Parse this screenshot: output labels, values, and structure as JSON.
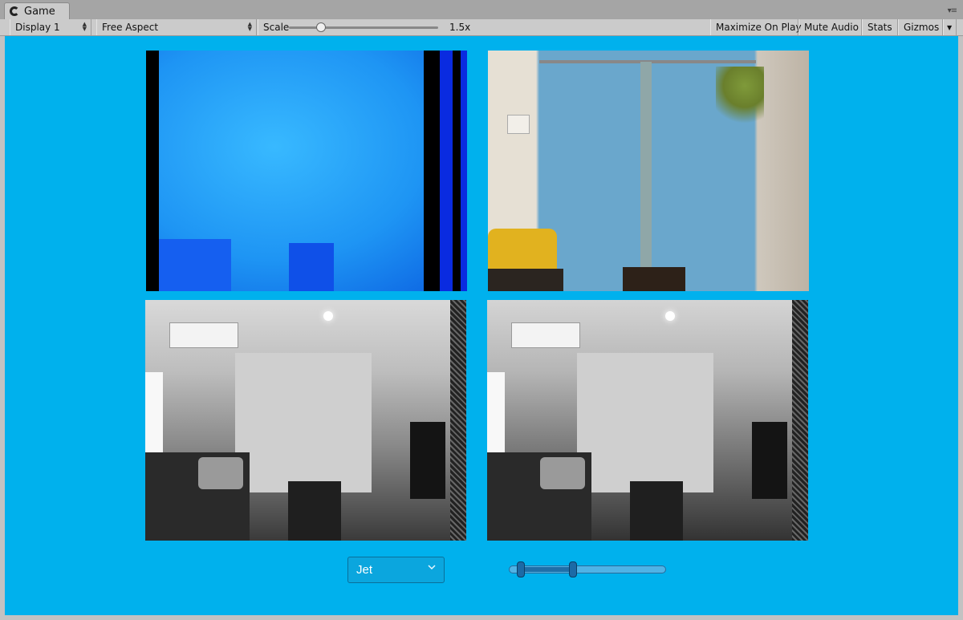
{
  "tab": {
    "title": "Game",
    "icon": "unity-logo-icon"
  },
  "toolbar": {
    "display": "Display 1",
    "aspect": "Free Aspect",
    "scale_label": "Scale",
    "scale_value": "1.5x",
    "maximize": "Maximize On Play",
    "mute": "Mute Audio",
    "stats": "Stats",
    "gizmos": "Gizmos"
  },
  "controls": {
    "colormap_selected": "Jet",
    "range_slider": {
      "low": 0.05,
      "high": 0.4
    }
  },
  "colors": {
    "game_background": "#00b1ed",
    "toolbar": "#cbcbcb"
  }
}
